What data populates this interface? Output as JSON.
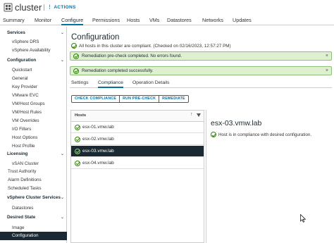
{
  "header": {
    "title": "cluster",
    "actions_label": "ACTIONS"
  },
  "tabs": [
    {
      "label": "Summary"
    },
    {
      "label": "Monitor"
    },
    {
      "label": "Configure",
      "active": true
    },
    {
      "label": "Permissions"
    },
    {
      "label": "Hosts"
    },
    {
      "label": "VMs"
    },
    {
      "label": "Datastores"
    },
    {
      "label": "Networks"
    },
    {
      "label": "Updates"
    }
  ],
  "sidebar": {
    "items": [
      {
        "label": "Services",
        "type": "section",
        "expanded": true
      },
      {
        "label": "vSphere DRS",
        "type": "child"
      },
      {
        "label": "vSphere Availability",
        "type": "child"
      },
      {
        "label": "Configuration",
        "type": "section",
        "expanded": true
      },
      {
        "label": "Quickstart",
        "type": "child"
      },
      {
        "label": "General",
        "type": "child"
      },
      {
        "label": "Key Provider",
        "type": "child"
      },
      {
        "label": "VMware EVC",
        "type": "child"
      },
      {
        "label": "VM/Host Groups",
        "type": "child"
      },
      {
        "label": "VM/Host Rules",
        "type": "child"
      },
      {
        "label": "VM Overrides",
        "type": "child"
      },
      {
        "label": "I/O Filters",
        "type": "child"
      },
      {
        "label": "Host Options",
        "type": "child"
      },
      {
        "label": "Host Profile",
        "type": "child"
      },
      {
        "label": "Licensing",
        "type": "section",
        "expanded": true
      },
      {
        "label": "vSAN Cluster",
        "type": "child"
      },
      {
        "label": "Trust Authority",
        "type": "plain"
      },
      {
        "label": "Alarm Definitions",
        "type": "plain"
      },
      {
        "label": "Scheduled Tasks",
        "type": "plain"
      },
      {
        "label": "vSphere Cluster Services",
        "type": "section",
        "expanded": true
      },
      {
        "label": "Datastores",
        "type": "child"
      },
      {
        "label": "Desired State",
        "type": "section",
        "expanded": true
      },
      {
        "label": "Image",
        "type": "child"
      },
      {
        "label": "Configuration",
        "type": "child",
        "selected": true
      }
    ]
  },
  "main": {
    "title": "Configuration",
    "compliance_status": "All hosts in this cluster are compliant. (Checked on 02/16/2023, 12:57:27 PM)",
    "banners": [
      {
        "text": "Remediation pre-check completed. No errors found."
      },
      {
        "text": "Remediation completed successfully."
      }
    ],
    "subtabs": [
      {
        "label": "Settings"
      },
      {
        "label": "Compliance",
        "active": true
      },
      {
        "label": "Operation Details"
      }
    ],
    "buttons": {
      "check_compliance": "CHECK COMPLIANCE",
      "run_precheck": "RUN PRE-CHECK",
      "remediate": "REMEDIATE"
    },
    "hosts": {
      "column_header": "Hosts",
      "rows": [
        {
          "name": "esx-01.vmw.lab"
        },
        {
          "name": "esx-02.vmw.lab"
        },
        {
          "name": "esx-03.vmw.lab",
          "selected": true
        },
        {
          "name": "esx-04.vmw.lab"
        }
      ]
    },
    "detail": {
      "host_name": "esx-03.vmw.lab",
      "status": "Host is in compliance with desired configuration."
    }
  },
  "colors": {
    "accent": "#0072a3",
    "dark_selection": "#1b2a32",
    "success_banner": "#dff0d0",
    "success_icon": "#2f8400"
  },
  "icons": [
    "cluster-icon",
    "dots-icon",
    "check-circle-icon",
    "close-icon",
    "sort-icon",
    "filter-icon",
    "cursor-icon"
  ]
}
